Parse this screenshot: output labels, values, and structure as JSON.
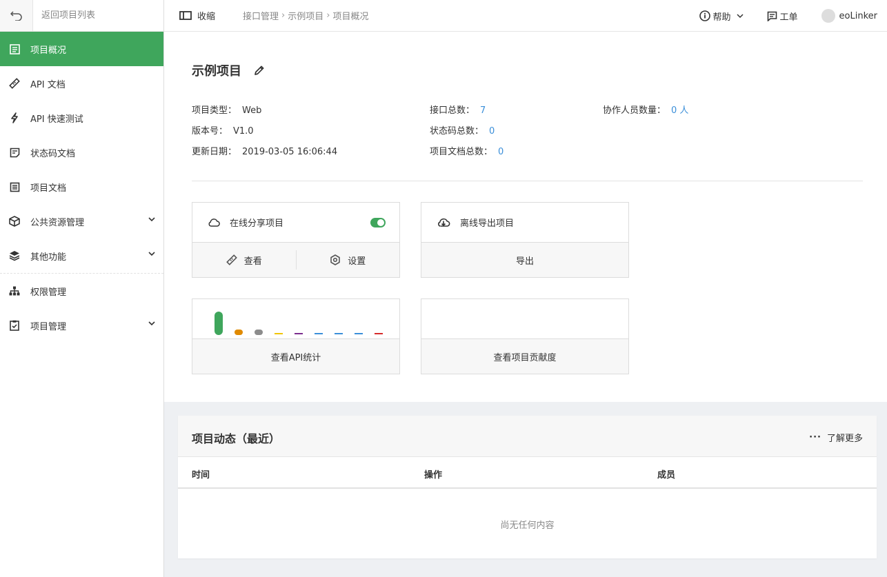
{
  "sidebar": {
    "back_label": "返回项目列表",
    "items": [
      {
        "label": "项目概况",
        "icon": "list-icon"
      },
      {
        "label": "API 文档",
        "icon": "ruler-icon"
      },
      {
        "label": "API 快速测试",
        "icon": "lightning-icon"
      },
      {
        "label": "状态码文档",
        "icon": "doc-icon"
      },
      {
        "label": "项目文档",
        "icon": "list-doc-icon"
      },
      {
        "label": "公共资源管理",
        "icon": "cube-icon"
      },
      {
        "label": "其他功能",
        "icon": "layers-icon"
      },
      {
        "label": "权限管理",
        "icon": "org-icon"
      },
      {
        "label": "项目管理",
        "icon": "clipboard-icon"
      }
    ]
  },
  "topbar": {
    "collapse_label": "收缩",
    "breadcrumb": [
      "接口管理",
      "示例项目",
      "项目概况"
    ],
    "help_label": "帮助",
    "ticket_label": "工单",
    "user_name": "eoLinker"
  },
  "project": {
    "title": "示例项目",
    "type_label": "项目类型：",
    "type_value": "Web",
    "version_label": "版本号：",
    "version_value": "V1.0",
    "updated_label": "更新日期：",
    "updated_value": "2019-03-05 16:06:44",
    "api_total_label": "接口总数：",
    "api_total_value": "7",
    "status_total_label": "状态码总数：",
    "status_total_value": "0",
    "doc_total_label": "项目文档总数：",
    "doc_total_value": "0",
    "members_label": "协作人员数量：",
    "members_value": "0 人"
  },
  "cards": {
    "share_title": "在线分享项目",
    "share_toggle_on": true,
    "view_label": "查看",
    "settings_label": "设置",
    "export_title": "离线导出项目",
    "export_label": "导出",
    "api_stats_label": "查看API统计",
    "contrib_label": "查看项目贡献度"
  },
  "mini_chart_colors": [
    "#3fa65c",
    "#e08a00",
    "#8c8c8c",
    "#f0c400",
    "#7b2d8e",
    "#3b8fd9",
    "#3b8fd9",
    "#3b8fd9",
    "#d62b2b"
  ],
  "activity": {
    "title": "项目动态（最近）",
    "more_label": "了解更多",
    "columns": [
      "时间",
      "操作",
      "成员"
    ],
    "empty_text": "尚无任何内容"
  },
  "colors": {
    "accent": "#3fa65c",
    "link": "#3b8fd9"
  }
}
